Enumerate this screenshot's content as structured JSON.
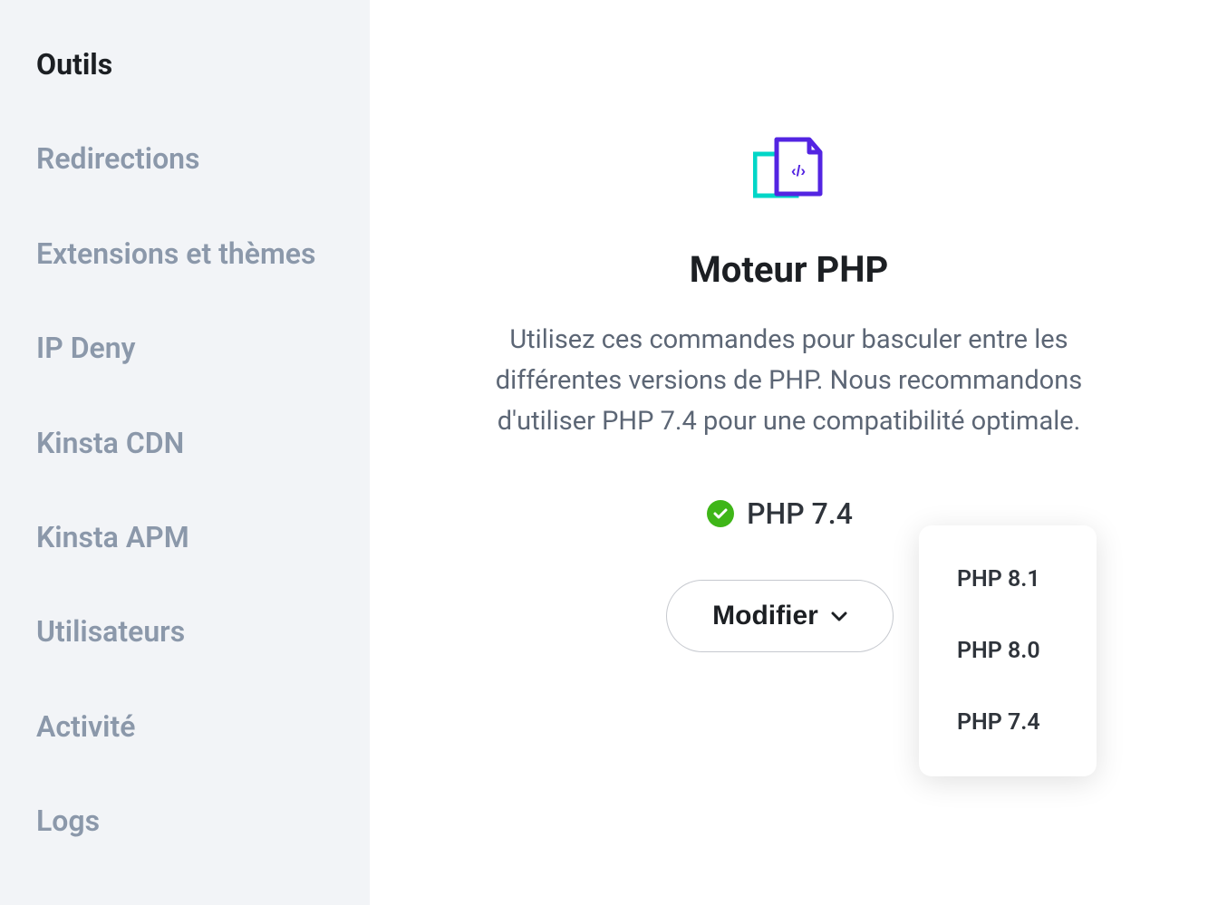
{
  "sidebar": {
    "items": [
      {
        "label": "Outils",
        "active": true
      },
      {
        "label": "Redirections",
        "active": false
      },
      {
        "label": "Extensions et thèmes",
        "active": false
      },
      {
        "label": "IP Deny",
        "active": false
      },
      {
        "label": "Kinsta CDN",
        "active": false
      },
      {
        "label": "Kinsta APM",
        "active": false
      },
      {
        "label": "Utilisateurs",
        "active": false
      },
      {
        "label": "Activité",
        "active": false
      },
      {
        "label": "Logs",
        "active": false
      }
    ]
  },
  "main": {
    "title": "Moteur PHP",
    "description": "Utilisez ces commandes pour basculer entre les différentes versions de PHP. Nous recommandons d'utiliser PHP 7.4 pour une compatibilité optimale.",
    "current_version": "PHP 7.4",
    "modify_button": "Modifier",
    "dropdown_options": [
      "PHP 8.1",
      "PHP 8.0",
      "PHP 7.4"
    ]
  }
}
